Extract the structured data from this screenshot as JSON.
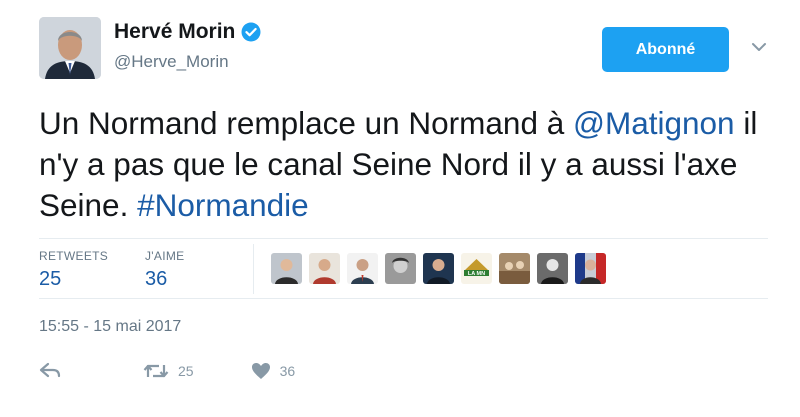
{
  "author": {
    "name": "Hervé Morin",
    "handle": "@Herve_Morin"
  },
  "follow_button": {
    "label": "Abonné"
  },
  "tweet": {
    "text_before": "Un Normand remplace un Normand à ",
    "mention": "@Matignon",
    "text_middle": " il n'y a pas que le canal Seine Nord il y a aussi l'axe Seine. ",
    "hashtag": "#Normandie"
  },
  "stats": {
    "retweets_label": "RETWEETS",
    "retweets_value": "25",
    "likes_label": "J'AIME",
    "likes_value": "36"
  },
  "likers": [
    {
      "icon": "user-avatar"
    },
    {
      "icon": "user-avatar"
    },
    {
      "icon": "user-avatar"
    },
    {
      "icon": "user-avatar"
    },
    {
      "icon": "user-avatar"
    },
    {
      "icon": "la-mn-logo",
      "text": "LA MN"
    },
    {
      "icon": "user-avatar"
    },
    {
      "icon": "user-avatar"
    },
    {
      "icon": "user-avatar"
    }
  ],
  "timestamp": "15:55 - 15 mai 2017",
  "actions": {
    "retweet_count": "25",
    "like_count": "36"
  },
  "colors": {
    "accent": "#1da1f2",
    "link": "#1b5ca6",
    "muted": "#657786"
  }
}
